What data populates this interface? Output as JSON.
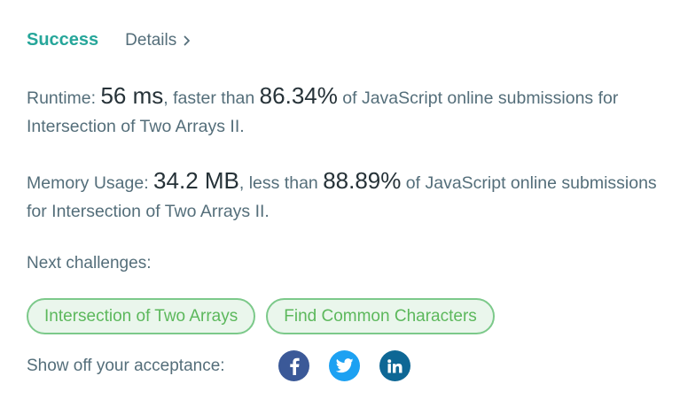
{
  "header": {
    "status": "Success",
    "details_link": "Details"
  },
  "runtime": {
    "label": "Runtime:",
    "value": "56 ms",
    "middle": ", faster than",
    "percentile": "86.34%",
    "suffix": "of JavaScript online submissions for Intersection of Two Arrays II."
  },
  "memory": {
    "label": "Memory Usage:",
    "value": "34.2 MB",
    "middle": ", less than",
    "percentile": "88.89%",
    "suffix": "of JavaScript online submissions for Intersection of Two Arrays II."
  },
  "next": {
    "label": "Next challenges:",
    "challenges": [
      "Intersection of Two Arrays",
      "Find Common Characters"
    ]
  },
  "share": {
    "label": "Show off your acceptance:",
    "icons": [
      {
        "name": "facebook-icon",
        "color": "#3b5998"
      },
      {
        "name": "twitter-icon",
        "color": "#1da1f2"
      },
      {
        "name": "linkedin-icon",
        "color": "#0e6795"
      }
    ]
  },
  "colors": {
    "success": "#26a69a",
    "chip_border": "#7cc98a",
    "chip_bg": "#eaf6ec",
    "chip_text": "#5cb85c",
    "text": "#546e7a",
    "strong_text": "#263238"
  }
}
